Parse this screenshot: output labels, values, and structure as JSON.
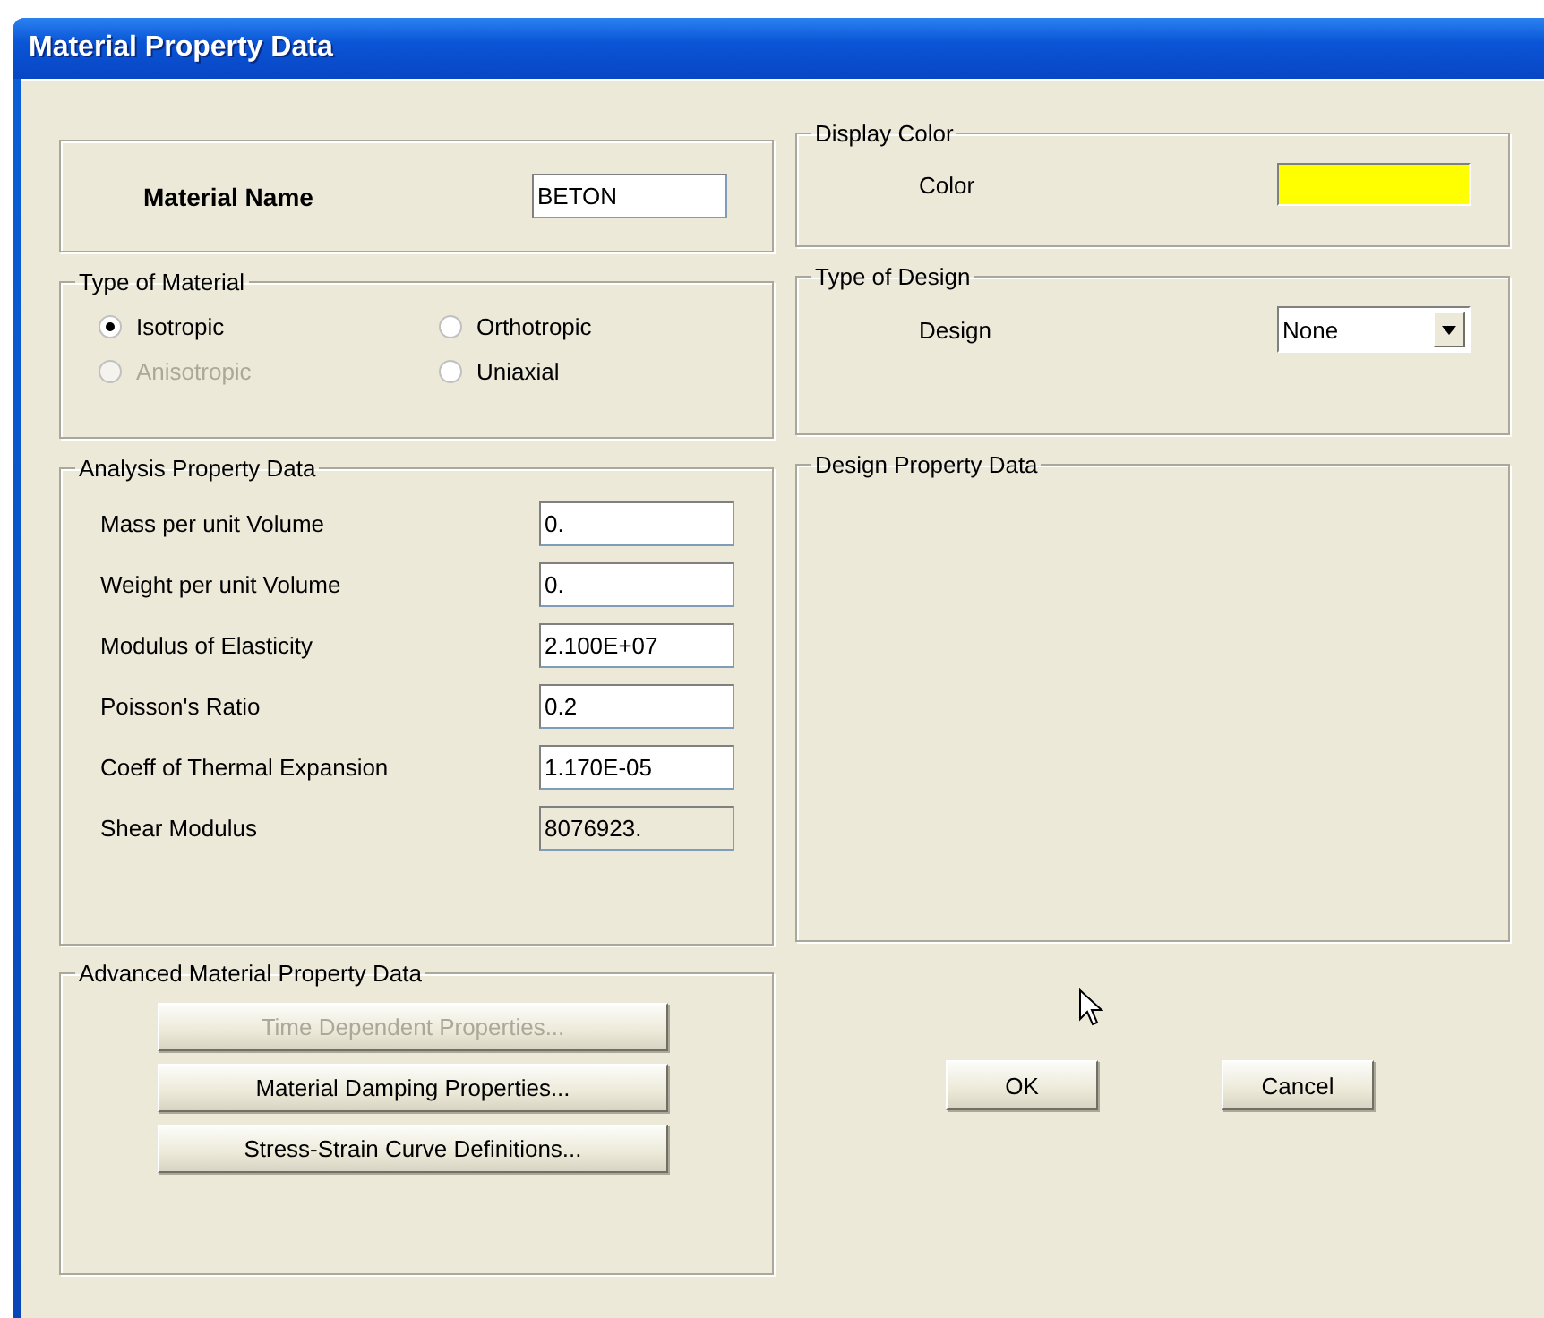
{
  "window": {
    "title": "Material Property Data"
  },
  "material_name": {
    "label": "Material Name",
    "value": "BETON"
  },
  "display_color": {
    "title": "Display Color",
    "label": "Color",
    "color": "#ffff00"
  },
  "type_of_material": {
    "title": "Type of Material",
    "options": [
      {
        "label": "Isotropic",
        "selected": true,
        "disabled": false
      },
      {
        "label": "Orthotropic",
        "selected": false,
        "disabled": false
      },
      {
        "label": "Anisotropic",
        "selected": false,
        "disabled": true
      },
      {
        "label": "Uniaxial",
        "selected": false,
        "disabled": false
      }
    ]
  },
  "type_of_design": {
    "title": "Type of Design",
    "label": "Design",
    "value": "None"
  },
  "analysis": {
    "title": "Analysis Property Data",
    "fields": [
      {
        "label": "Mass per unit Volume",
        "value": "0.",
        "disabled": false
      },
      {
        "label": "Weight per unit Volume",
        "value": "0.",
        "disabled": false
      },
      {
        "label": "Modulus of Elasticity",
        "value": "2.100E+07",
        "disabled": false
      },
      {
        "label": "Poisson's Ratio",
        "value": "0.2",
        "disabled": false
      },
      {
        "label": "Coeff of Thermal Expansion",
        "value": "1.170E-05",
        "disabled": false
      },
      {
        "label": "Shear Modulus",
        "value": "8076923.",
        "disabled": true
      }
    ]
  },
  "design_property_data": {
    "title": "Design Property Data"
  },
  "advanced": {
    "title": "Advanced Material Property Data",
    "buttons": [
      {
        "label": "Time Dependent Properties...",
        "disabled": true
      },
      {
        "label": "Material Damping Properties...",
        "disabled": false
      },
      {
        "label": "Stress-Strain Curve Definitions...",
        "disabled": false
      }
    ]
  },
  "buttons": [
    "OK",
    "Cancel"
  ]
}
